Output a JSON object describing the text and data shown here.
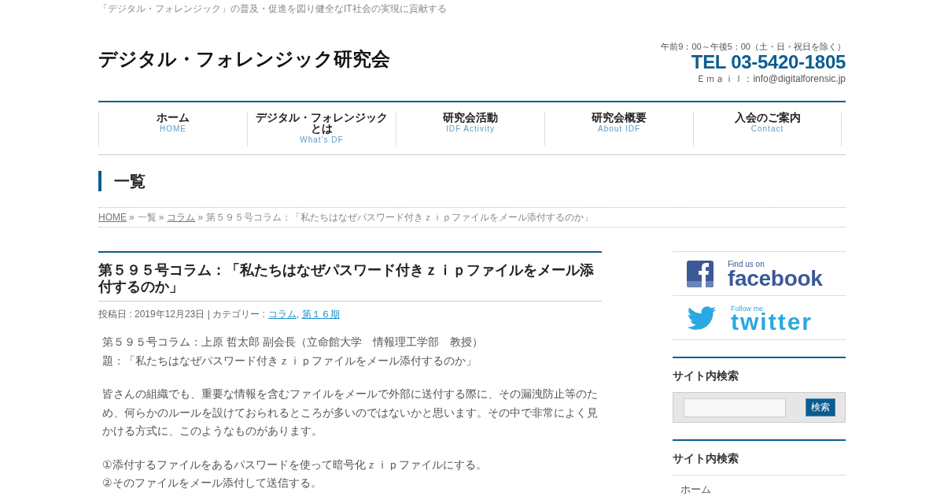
{
  "tagline": "「デジタル・フォレンジック」の普及・促進を図り健全なIT社会の実現に貢献する",
  "header": {
    "site_title": "デジタル・フォレンジック研究会",
    "hours": "午前9：00～午後5：00（土・日・祝日を除く）",
    "tel": "TEL 03-5420-1805",
    "email": "Ｅｍａｉｌ：info@digitalforensic.jp"
  },
  "nav": [
    {
      "label": "ホーム",
      "sub": "HOME"
    },
    {
      "label": "デジタル・フォレンジックとは",
      "sub": "What's DF"
    },
    {
      "label": "研究会活動",
      "sub": "IDF Activity"
    },
    {
      "label": "研究会概要",
      "sub": "About IDF"
    },
    {
      "label": "入会のご案内",
      "sub": "Contact"
    }
  ],
  "page_heading": "一覧",
  "breadcrumb": [
    {
      "kind": "link",
      "label": "HOME"
    },
    {
      "kind": "separator",
      "label": "»"
    },
    {
      "kind": "text",
      "label": "一覧"
    },
    {
      "kind": "separator",
      "label": "»"
    },
    {
      "kind": "link",
      "label": "コラム"
    },
    {
      "kind": "separator",
      "label": "»"
    },
    {
      "kind": "text",
      "label": "第５９５号コラム：「私たちはなぜパスワード付きｚｉｐファイルをメール添付するのか」"
    }
  ],
  "article": {
    "title": "第５９５号コラム：「私たちはなぜパスワード付きｚｉｐファイルをメール添付するのか」",
    "meta": {
      "posted": "投稿日 : 2019年12月23日 | カテゴリー :",
      "categories": [
        {
          "label": "コラム"
        },
        {
          "label": "第１６期"
        }
      ],
      "separator": ","
    },
    "paragraphs": [
      {
        "lines": [
          "第５９５号コラム：上原 哲太郎 副会長（立命館大学　情報理工学部　教授）",
          "題：「私たちはなぜパスワード付きｚｉｐファイルをメール添付するのか」"
        ]
      },
      {
        "lines": [
          "皆さんの組織でも、重要な情報を含むファイルをメールで外部に送付する際に、その漏洩防止等のため、何らかのルールを設けておられるところが多いのではないかと思います。その中で非常によく見かける方式に、このようなものがあります。"
        ]
      },
      {
        "lines": [
          "①添付するファイルをあるパスワードを使って暗号化ｚｉｐファイルにする。",
          "②そのファイルをメール添付して送信する。"
        ]
      }
    ]
  },
  "sidebar": {
    "social": [
      {
        "kind": "facebook",
        "small": "Find us on",
        "big": "facebook"
      },
      {
        "kind": "twitter",
        "small": "Follow me",
        "big": "twitter"
      }
    ],
    "widgets": [
      {
        "kind": "search",
        "heading": "サイト内検索",
        "button": "検索"
      },
      {
        "kind": "menu",
        "heading": "サイト内検索",
        "items": [
          {
            "label": "ホーム"
          }
        ]
      }
    ]
  }
}
